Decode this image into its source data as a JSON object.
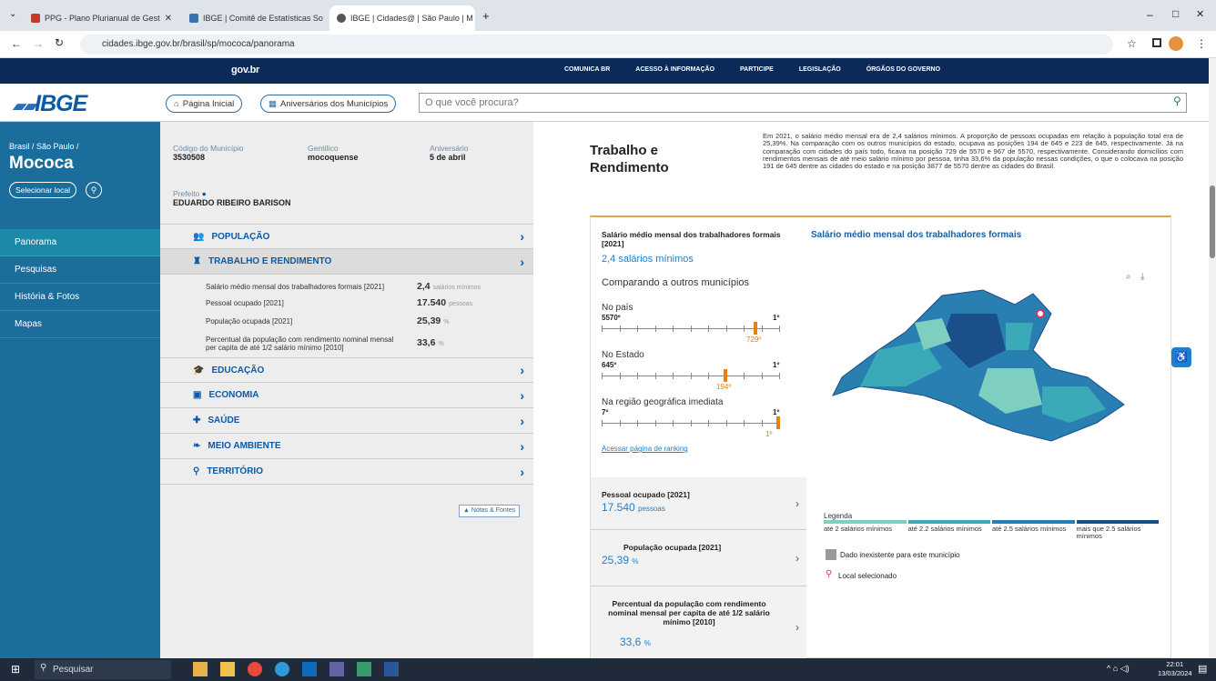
{
  "browser": {
    "tabs": [
      {
        "title": "PPG - Plano Plurianual de Gest",
        "color": "#c0392b"
      },
      {
        "title": "IBGE | Comitê de Estatísticas So",
        "color": "#3a6fb0"
      },
      {
        "title": "IBGE | Cidades@ | São Paulo | M",
        "color": "#555555"
      }
    ],
    "url": "cidades.ibge.gov.br/brasil/sp/mococa/panorama",
    "controls": {
      "min": "–",
      "max": "□",
      "close": "✕"
    }
  },
  "govbar": {
    "logo": "gov.br",
    "links": [
      "COMUNICA BR",
      "ACESSO À INFORMAÇÃO",
      "PARTICIPE",
      "LEGISLAÇÃO",
      "ÓRGÃOS DO GOVERNO"
    ]
  },
  "header": {
    "logo": "IBGE",
    "home_button": "Página Inicial",
    "anniv_button": "Aniversários dos Municípios",
    "search_placeholder": "O que você procura?"
  },
  "sidebar": {
    "breadcrumb": "Brasil / São Paulo /",
    "city": "Mococa",
    "select_button": "Selecionar local",
    "items": [
      "Panorama",
      "Pesquisas",
      "História & Fotos",
      "Mapas"
    ]
  },
  "info": {
    "code_label": "Código do Município",
    "code": "3530508",
    "gentilic_label": "Gentílico",
    "gentilic": "mocoquense",
    "anniv_label": "Aniversário",
    "anniv": "5 de abril",
    "mayor_label": "Prefeito",
    "mayor": "EDUARDO RIBEIRO BARISON"
  },
  "accordion": {
    "populacao": "POPULAÇÃO",
    "trabalho": "TRABALHO E RENDIMENTO",
    "educacao": "EDUCAÇÃO",
    "economia": "ECONOMIA",
    "saude": "SAÚDE",
    "meio": "MEIO AMBIENTE",
    "territorio": "TERRITÓRIO",
    "rows": [
      {
        "label": "Salário médio mensal dos trabalhadores formais [2021]",
        "value": "2,4",
        "unit": "salários mínimos"
      },
      {
        "label": "Pessoal ocupado [2021]",
        "value": "17.540",
        "unit": "pessoas"
      },
      {
        "label": "População ocupada [2021]",
        "value": "25,39",
        "unit": "%"
      },
      {
        "label": "Percentual da população com rendimento nominal mensal per capita de até 1/2 salário mínimo [2010]",
        "value": "33,6",
        "unit": "%"
      }
    ],
    "notes_button": "Notas & Fontes"
  },
  "main": {
    "section_title_1": "Trabalho e",
    "section_title_2": "Rendimento",
    "description": "Em 2021, o salário médio mensal era de 2,4 salários mínimos. A proporção de pessoas ocupadas em relação à população total era de 25,39%. Na comparação com os outros municípios do estado, ocupava as posições 194 de 645 e 223 de 645, respectivamente. Já na comparação com cidades do país todo, ficava na posição 729 de 5570 e 967 de 5570, respectivamente. Considerando domicílios com rendimentos mensais de até meio salário mínimo por pessoa, tinha 33,6% da população nessas condições, o que o colocava na posição 191 de 645 dentre as cidades do estado e na posição 3877 de 5570 dentre as cidades do Brasil.",
    "card_title": "Salário médio mensal dos trabalhadores formais [2021]",
    "card_value": "2,4 salários mínimos",
    "compare_title": "Comparando a outros municípios",
    "ranks": [
      {
        "label": "No país",
        "left": "5570º",
        "right": "1º",
        "pos": "729º",
        "fraction": 0.87
      },
      {
        "label": "No Estado",
        "left": "645º",
        "right": "1º",
        "pos": "194º",
        "fraction": 0.7
      },
      {
        "label": "Na região geográfica imediata",
        "left": "7º",
        "right": "1º",
        "pos": "1º",
        "fraction": 1.0
      }
    ],
    "ranking_link": "Acessar página de ranking",
    "side_cards": [
      {
        "title": "Pessoal ocupado [2021]",
        "value": "17.540",
        "unit": "pessoas"
      },
      {
        "title": "População ocupada [2021]",
        "value": "25,39",
        "unit": "%"
      },
      {
        "title": "Percentual da população com rendimento nominal mensal per capita de até 1/2 salário mínimo [2010]",
        "value": "33,6",
        "unit": "%"
      }
    ],
    "map_title": "Salário médio mensal dos trabalhadores formais",
    "legend_title": "Legenda",
    "legend": [
      {
        "label": "até 2 salários mínimos",
        "color": "#7ecfc0"
      },
      {
        "label": "até 2.2 salários mínimos",
        "color": "#3aa9b8"
      },
      {
        "label": "até 2.5 salários mínimos",
        "color": "#2a7fb2"
      },
      {
        "label": "mais que 2.5 salários mínimos",
        "color": "#1b4f8a"
      }
    ],
    "legend_none": "Dado inexistente para este município",
    "legend_selected": "Local selecionado"
  },
  "taskbar": {
    "search": "Pesquisar",
    "time": "22:01",
    "date": "13/03/2024"
  }
}
